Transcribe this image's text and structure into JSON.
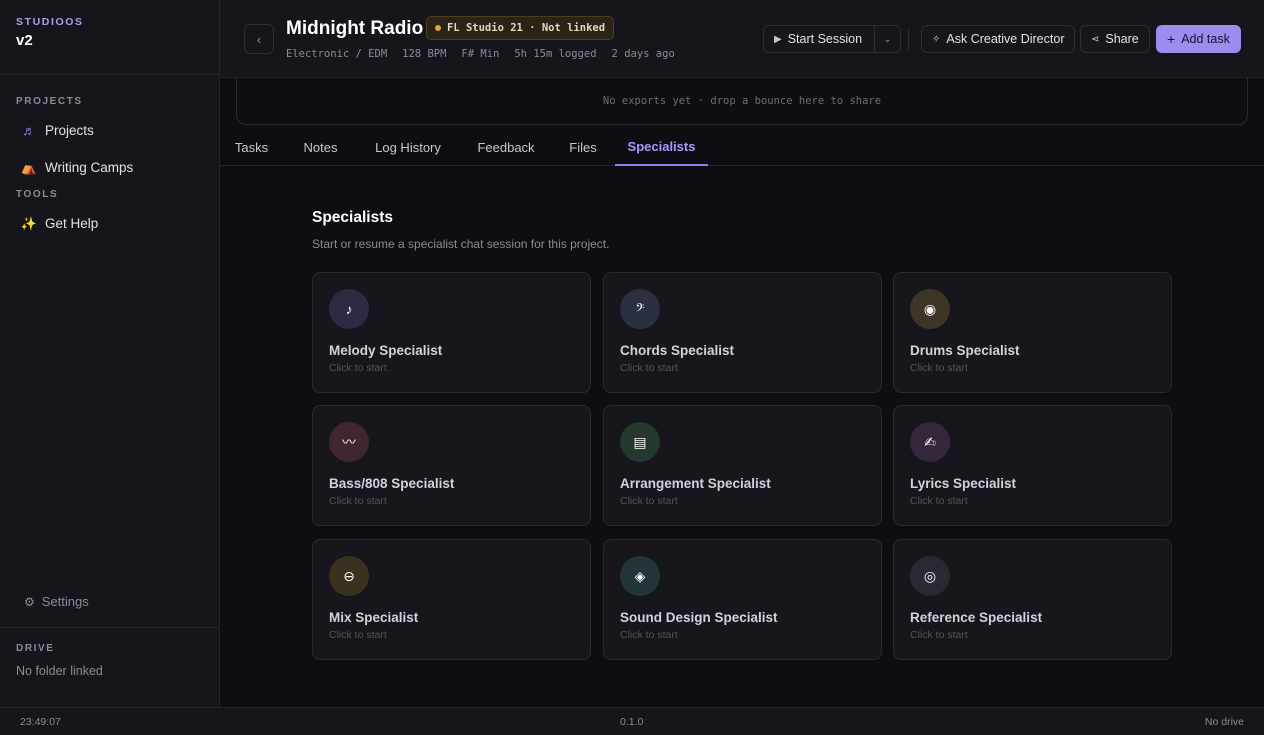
{
  "sidebar": {
    "brand_top": "STUDIOOS",
    "brand_version": "v2",
    "projects_label": "PROJECTS",
    "projects_items": [
      {
        "label": "Projects",
        "icon": "♬"
      },
      {
        "label": "Writing Camps",
        "icon": "⛺"
      }
    ],
    "tools_label": "TOOLS",
    "tools_items": [
      {
        "label": "Get Help",
        "icon": "✨"
      }
    ],
    "settings_label": "Settings",
    "drive_label": "DRIVE",
    "drive_value": "No folder linked"
  },
  "header": {
    "title": "Midnight Radio",
    "badge": "FL Studio 21 · Not linked",
    "meta": [
      "Electronic / EDM",
      "128 BPM",
      "F# Min",
      "5h 15m logged",
      "2 days ago"
    ],
    "start_session": "Start Session",
    "ask_director": "Ask Creative Director",
    "share": "Share",
    "add_task": "Add task"
  },
  "exports_text": "No exports yet · drop a bounce here to share",
  "tabs": [
    "Tasks",
    "Notes",
    "Log History",
    "Feedback",
    "Files",
    "Specialists"
  ],
  "active_tab": "Specialists",
  "specialists": {
    "title": "Specialists",
    "subtitle": "Start or resume a specialist chat session for this project.",
    "cards": [
      {
        "name": "Melody Specialist",
        "sub": "Click to start",
        "icon": "♪",
        "color": "#2e2a44"
      },
      {
        "name": "Chords Specialist",
        "sub": "Click to start",
        "icon": "𝄢",
        "color": "#2a3040"
      },
      {
        "name": "Drums Specialist",
        "sub": "Click to start",
        "icon": "◉",
        "color": "#3d3526"
      },
      {
        "name": "Bass/808 Specialist",
        "sub": "Click to start",
        "icon": "〰",
        "color": "#3f2630"
      },
      {
        "name": "Arrangement Specialist",
        "sub": "Click to start",
        "icon": "▤",
        "color": "#24382e"
      },
      {
        "name": "Lyrics Specialist",
        "sub": "Click to start",
        "icon": "✍",
        "color": "#35283d"
      },
      {
        "name": "Mix Specialist",
        "sub": "Click to start",
        "icon": "⊖",
        "color": "#38321f"
      },
      {
        "name": "Sound Design Specialist",
        "sub": "Click to start",
        "icon": "◈",
        "color": "#22353a"
      },
      {
        "name": "Reference Specialist",
        "sub": "Click to start",
        "icon": "◎",
        "color": "#2a2931"
      }
    ]
  },
  "status": {
    "time": "23:49:07",
    "version": "0.1.0",
    "drive": "No drive"
  }
}
